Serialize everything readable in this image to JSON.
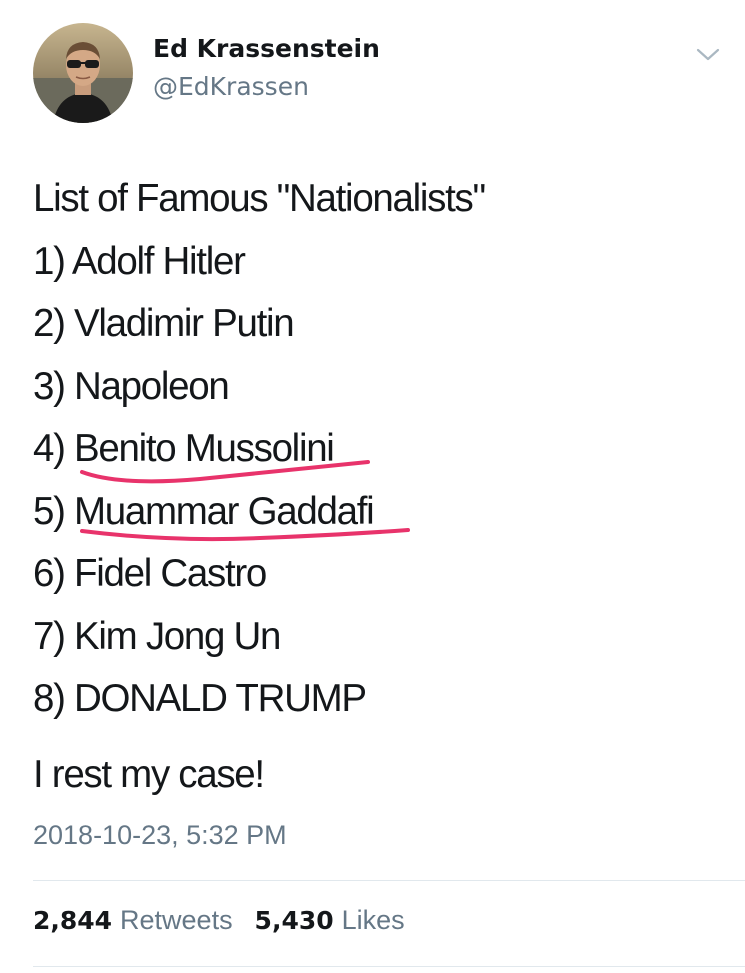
{
  "header": {
    "display_name": "Ed Krassenstein",
    "handle": "@EdKrassen",
    "menu_icon": "chevron-down-icon",
    "avatar_icon": "avatar-photo"
  },
  "tweet": {
    "lines": [
      "List of Famous \"Nationalists\"",
      "1) Adolf Hitler",
      "2) Vladimir Putin",
      "3) Napoleon",
      "4) Benito Mussolini",
      "5) Muammar Gaddafi",
      "6) Fidel Castro",
      "7) Kim Jong Un",
      "8) DONALD TRUMP"
    ],
    "closing": "I rest my case!",
    "timestamp": "2018-10-23, 5:32 PM",
    "underline_color": "#e8336b"
  },
  "stats": {
    "retweets_count": "2,844",
    "retweets_label": "Retweets",
    "likes_count": "5,430",
    "likes_label": "Likes"
  },
  "colors": {
    "text": "#14171a",
    "secondary": "#657786",
    "divider": "#e1e8ed"
  }
}
